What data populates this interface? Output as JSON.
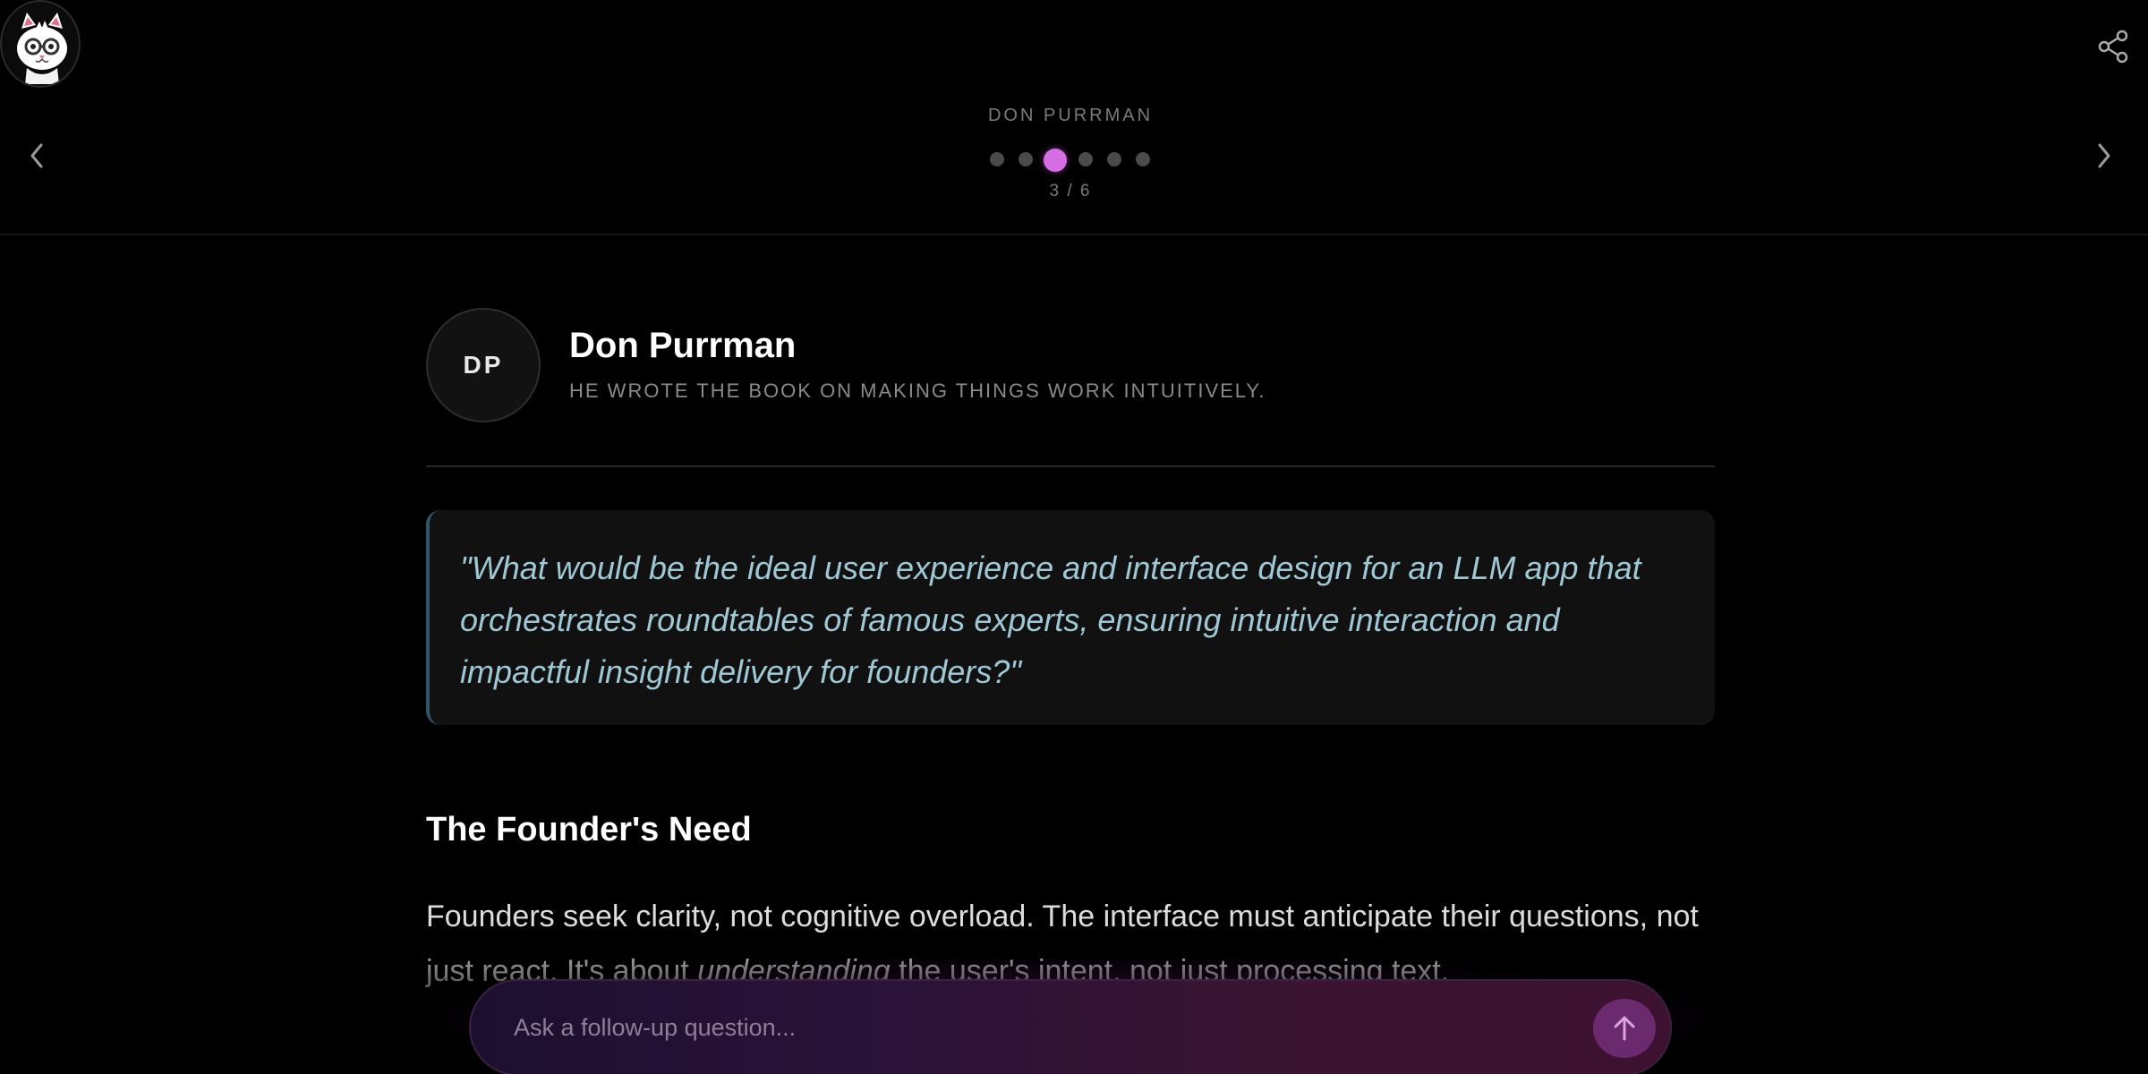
{
  "header": {
    "logo_icon": "cat-with-glasses-logo",
    "share_icon": "share-icon",
    "prev_icon": "chevron-left-icon",
    "next_icon": "chevron-right-icon"
  },
  "carousel": {
    "speaker_label": "DON PURRMAN",
    "total": 6,
    "active_index": 3,
    "counter": "3 / 6",
    "active_color": "#d86ee6",
    "inactive_color": "#4a4a4a"
  },
  "expert": {
    "initials": "DP",
    "name": "Don Purrman",
    "tagline": "HE WROTE THE BOOK ON MAKING THINGS WORK INTUITIVELY."
  },
  "quote": {
    "text": "\"What would be the ideal user experience and interface design for an LLM app that orchestrates roundtables of famous experts, ensuring intuitive interaction and impactful insight delivery for founders?\"",
    "accent_color": "#9fc8d4"
  },
  "section": {
    "title": "The Founder's Need",
    "para_part1": "Founders seek clarity, not cognitive overload. The interface must anticipate their questions, not just react. It's about ",
    "para_emphasis": "understanding",
    "para_part2": " the user's intent, not just processing text."
  },
  "followup": {
    "placeholder": "Ask a follow-up question...",
    "send_icon": "arrow-up-icon"
  }
}
